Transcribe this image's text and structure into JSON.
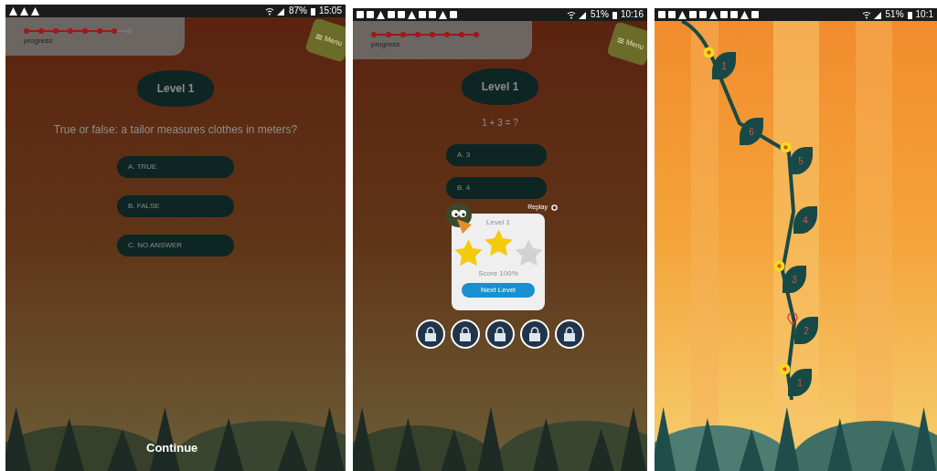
{
  "screens": [
    {
      "kind": "quiz",
      "status_bar": {
        "battery": "87%",
        "time": "15:05"
      },
      "progress": {
        "label": "progress",
        "steps": [
          {
            "done": true
          },
          {
            "done": true
          },
          {
            "done": true
          },
          {
            "done": true
          },
          {
            "done": true
          },
          {
            "done": true
          },
          {
            "done": true
          },
          {
            "done": false
          }
        ]
      },
      "menu_button": "Menu",
      "level_badge": "Level 1",
      "question": "True or false: a tailor measures clothes in meters?",
      "answers": [
        "A. TRUE",
        "B. FALSE",
        "C. NO ANSWER"
      ],
      "continue": "Continue"
    },
    {
      "kind": "result",
      "status_bar": {
        "battery": "51%",
        "time": "10:16"
      },
      "progress": {
        "label": "progress",
        "steps": [
          {
            "done": true
          },
          {
            "done": true
          },
          {
            "done": true
          },
          {
            "done": true
          },
          {
            "done": true
          },
          {
            "done": true
          },
          {
            "done": true
          },
          {
            "done": true
          }
        ]
      },
      "menu_button": "Menu",
      "level_badge": "Level 1",
      "question": "1 + 3 = ?",
      "answers": [
        "A. 3",
        "B. 4"
      ],
      "dialog": {
        "replay": "Replay",
        "title": "Level 1",
        "stars": 2,
        "score": "Score 100%",
        "next": "Next Level"
      },
      "levels": [
        {
          "locked": true
        },
        {
          "locked": true
        },
        {
          "locked": true
        },
        {
          "locked": true
        },
        {
          "locked": true
        }
      ]
    },
    {
      "kind": "map",
      "status_bar": {
        "battery": "51%",
        "time": "10:1"
      },
      "leaves": [
        {
          "label": "1",
          "flower": true,
          "selected": false
        },
        {
          "label": "6",
          "flower": false,
          "selected": false
        },
        {
          "label": "5",
          "flower": true,
          "selected": false
        },
        {
          "label": "4",
          "flower": false,
          "selected": false
        },
        {
          "label": "3",
          "flower": true,
          "selected": false
        },
        {
          "label": "2",
          "flower": false,
          "selected": true
        },
        {
          "label": "1",
          "flower": true,
          "selected": false
        }
      ]
    }
  ]
}
